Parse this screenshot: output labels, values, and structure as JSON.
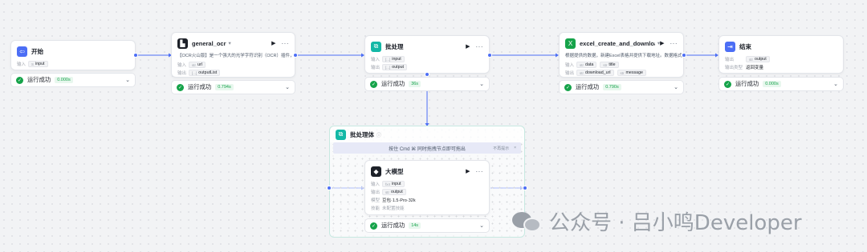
{
  "nodes": {
    "start": {
      "title": "开始",
      "inputs_label": "输入",
      "input_param": {
        "type": "S",
        "name": "input"
      },
      "status": "运行成功",
      "time": "0.000s"
    },
    "ocr": {
      "title": "general_ocr",
      "badge": "▾",
      "description": "【OCR火山版】是一个强大的光学字符识别（OCR）插件，能...",
      "inputs_label": "输入",
      "input_param": {
        "type": "str",
        "name": "url"
      },
      "outputs_label": "输出",
      "output_param": {
        "type": "[...]",
        "name": "outputList"
      },
      "status": "运行成功",
      "time": "0.794s"
    },
    "batch": {
      "title": "批处理",
      "inputs_label": "输入",
      "input_param": {
        "type": "[...]",
        "name": "input"
      },
      "outputs_label": "输出",
      "output_param": {
        "type": "[...]",
        "name": "output"
      },
      "status": "运行成功",
      "time": "36s"
    },
    "excel": {
      "title": "excel_create_and_download",
      "badge": "▾",
      "description": "根据提供的数据，新建Excel表格并提供下载地址。数据格式支...",
      "inputs_label": "输入",
      "input_params": [
        {
          "type": "str",
          "name": "data"
        },
        {
          "type": "str",
          "name": "title"
        }
      ],
      "outputs_label": "输出",
      "output_params": [
        {
          "type": "str",
          "name": "download_url"
        },
        {
          "type": "str",
          "name": "message"
        }
      ],
      "status": "运行成功",
      "time": "0.790s"
    },
    "end": {
      "title": "结束",
      "outputs_label": "输出",
      "output_param": {
        "type": "str",
        "name": "output"
      },
      "output_type_label": "输出类型",
      "output_type_value": "返回变量",
      "status": "运行成功",
      "time": "0.000s"
    },
    "batch_body": {
      "title": "批处理体",
      "info": "ⓘ",
      "hint": "按住 Cmd ⌘ 同时拖拽节点即可拖出",
      "hint_dismiss": "不再提示",
      "hint_close": "×"
    },
    "llm": {
      "title": "大模型",
      "inputs_label": "输入",
      "input_param": {
        "type": "fx4",
        "name": "input"
      },
      "outputs_label": "输出",
      "output_param": {
        "type": "str",
        "name": "output"
      },
      "model_label": "模型",
      "model_value": "豆包·1.5·Pro·32k",
      "skill_label": "技能",
      "skill_value": "未配置技能",
      "status": "运行成功",
      "time": "14s"
    }
  },
  "icons": {
    "run": "play-icon",
    "more": "more-icon",
    "ok": "check-circle-icon",
    "expand": "chevron-down-icon"
  },
  "colors": {
    "accent": "#4c6ef5",
    "success": "#16a34a",
    "teal": "#14b8a6"
  },
  "watermark": {
    "text": "公众号 · 吕小鸣Developer"
  }
}
